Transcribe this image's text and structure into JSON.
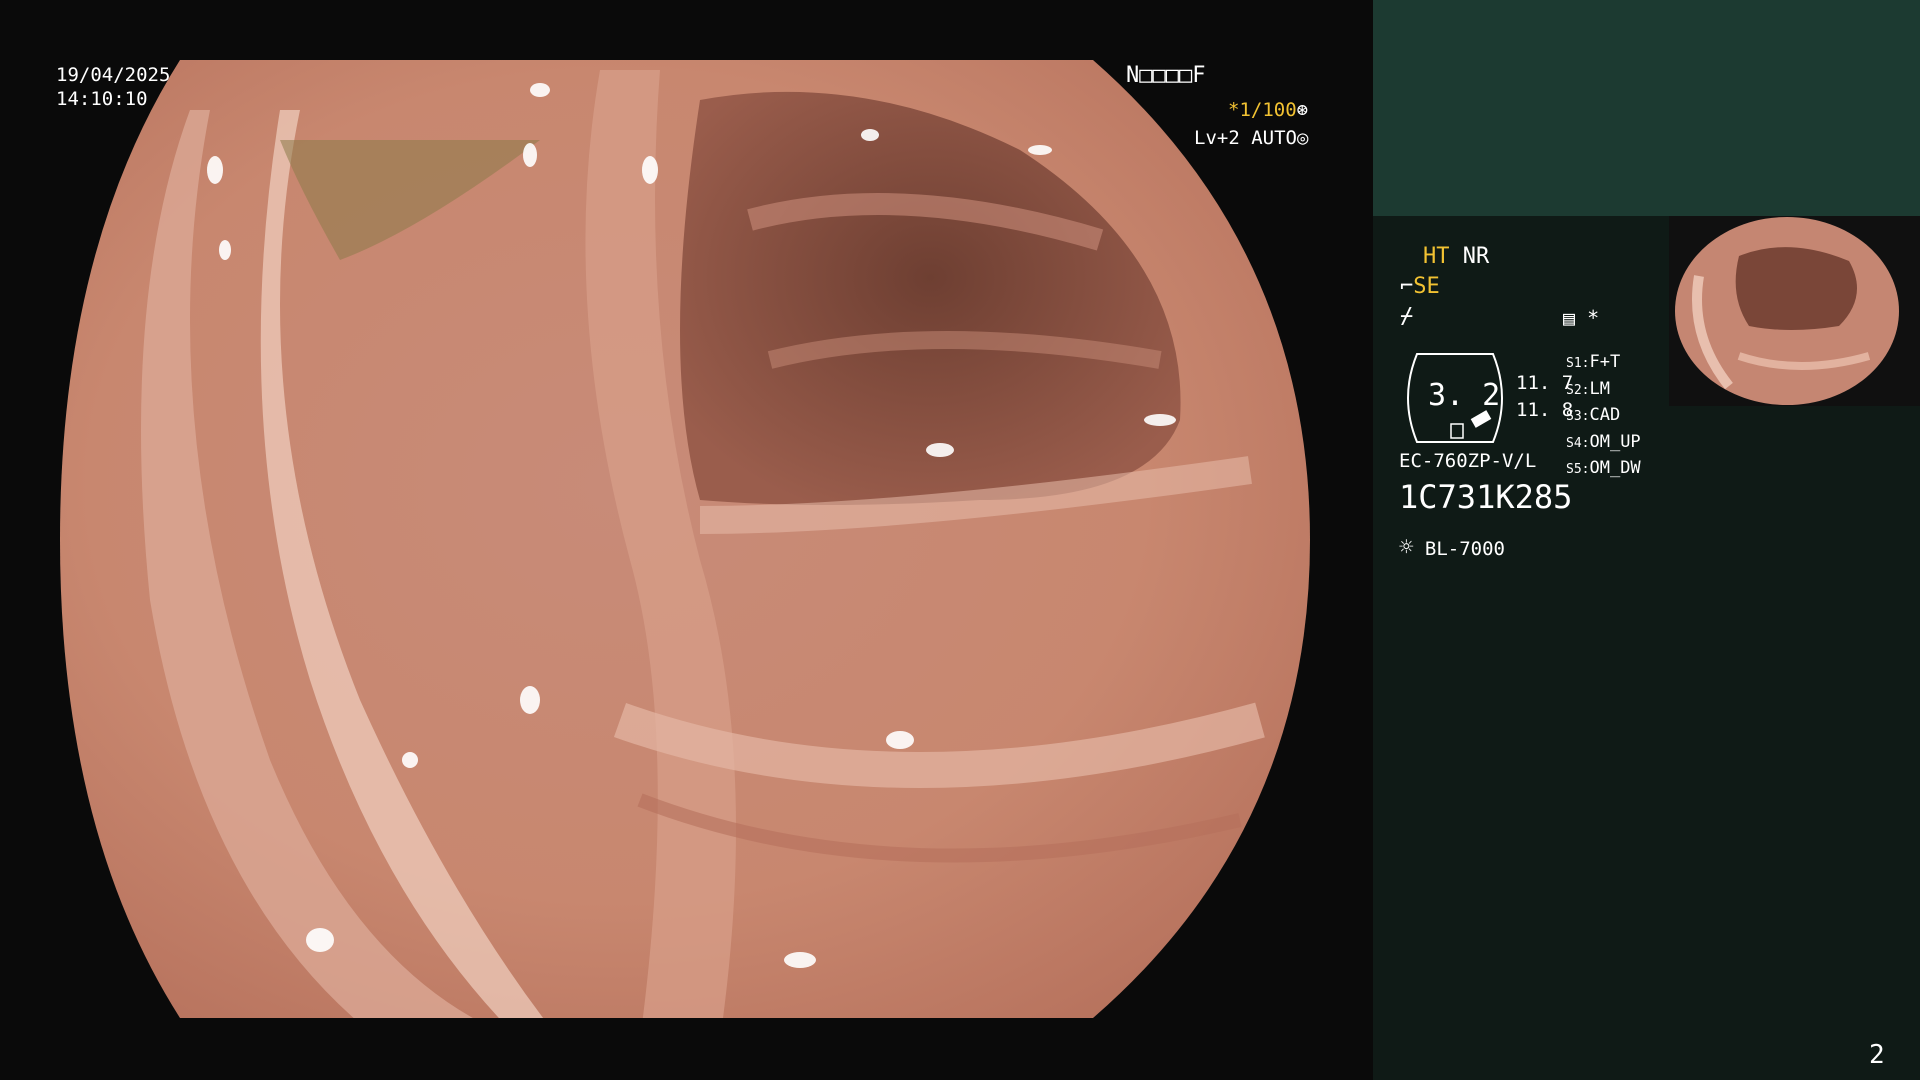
{
  "overlay": {
    "date": "19/04/2025",
    "time": "14:10:10",
    "mode_code": "N□□□□F",
    "shutter": "*1/100",
    "level": "Lv+2",
    "auto": "AUTO"
  },
  "side_panel": {
    "ht": "HT",
    "nr": "NR",
    "se": "SE",
    "star": "*",
    "zoom_value": "3. 2",
    "reading_1": "11. 7",
    "reading_2": "11. 8",
    "settings": [
      {
        "key": "S1:",
        "value": "F+T"
      },
      {
        "key": "S2:",
        "value": "LM"
      },
      {
        "key": "S3:",
        "value": "CAD"
      },
      {
        "key": "S4:",
        "value": "OM_UP"
      },
      {
        "key": "S5:",
        "value": "OM_DW"
      }
    ],
    "scope_model": "EC-760ZP-V/L",
    "serial": "1C731K285",
    "light_source": "BL-7000",
    "page_number": "2"
  },
  "colors": {
    "panel_bg": "#0f1a16",
    "panel_top": "#1c3a31",
    "accent_yellow": "#f2c232"
  },
  "icons": {
    "shutter": "aperture-icon",
    "auto": "target-icon",
    "scope": "scope-bend-icon",
    "slash": "flash-slash-icon",
    "memo": "document-icon",
    "lamp": "light-bulb-icon"
  }
}
